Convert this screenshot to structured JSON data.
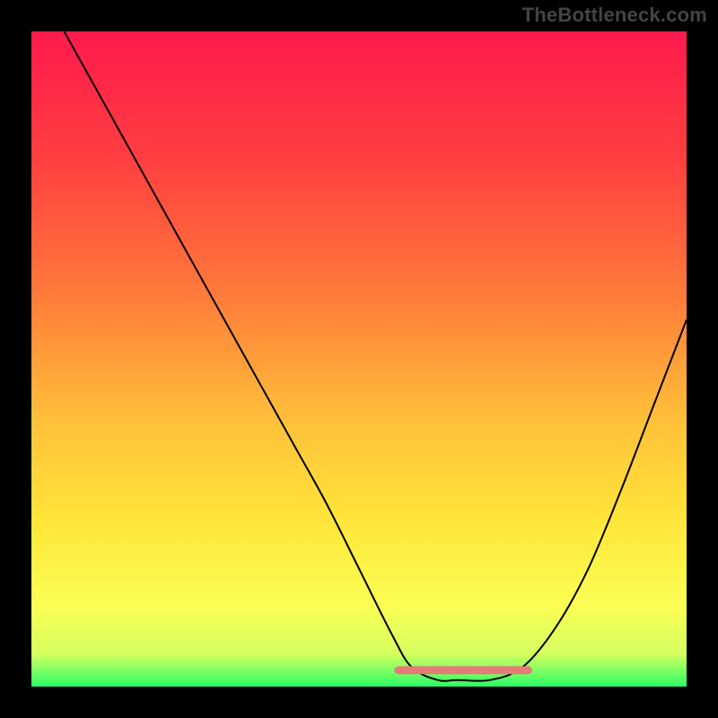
{
  "watermark": "TheBottleneck.com",
  "chart_data": {
    "type": "line",
    "title": "",
    "xlabel": "",
    "ylabel": "",
    "xlim": [
      0,
      100
    ],
    "ylim": [
      0,
      100
    ],
    "grid": false,
    "legend": false,
    "background_gradient": {
      "stops": [
        {
          "offset": 0.0,
          "color": "#ff1a4d"
        },
        {
          "offset": 0.2,
          "color": "#ff4040"
        },
        {
          "offset": 0.4,
          "color": "#ff7a3a"
        },
        {
          "offset": 0.6,
          "color": "#ffc23a"
        },
        {
          "offset": 0.75,
          "color": "#ffe63a"
        },
        {
          "offset": 0.88,
          "color": "#faff55"
        },
        {
          "offset": 0.95,
          "color": "#d5ff60"
        },
        {
          "offset": 1.0,
          "color": "#2bff66"
        }
      ]
    },
    "series": [
      {
        "name": "bottleneck-curve",
        "type": "v-curve",
        "color": "#000000",
        "width": 2,
        "x": [
          5,
          10,
          15,
          20,
          25,
          30,
          35,
          40,
          45,
          50,
          55,
          58,
          62,
          65,
          70,
          75,
          80,
          85,
          90,
          95,
          100
        ],
        "y": [
          100,
          91,
          82,
          73,
          64,
          55,
          46,
          37,
          28,
          18,
          8,
          3,
          1,
          1,
          1,
          3,
          9,
          18,
          30,
          43,
          56
        ]
      },
      {
        "name": "sweet-spot-band",
        "type": "segment",
        "color": "#e47b76",
        "width": 9,
        "dash": [
          12,
          9
        ],
        "x": [
          56,
          76
        ],
        "y": [
          2.5,
          2.5
        ]
      }
    ]
  }
}
